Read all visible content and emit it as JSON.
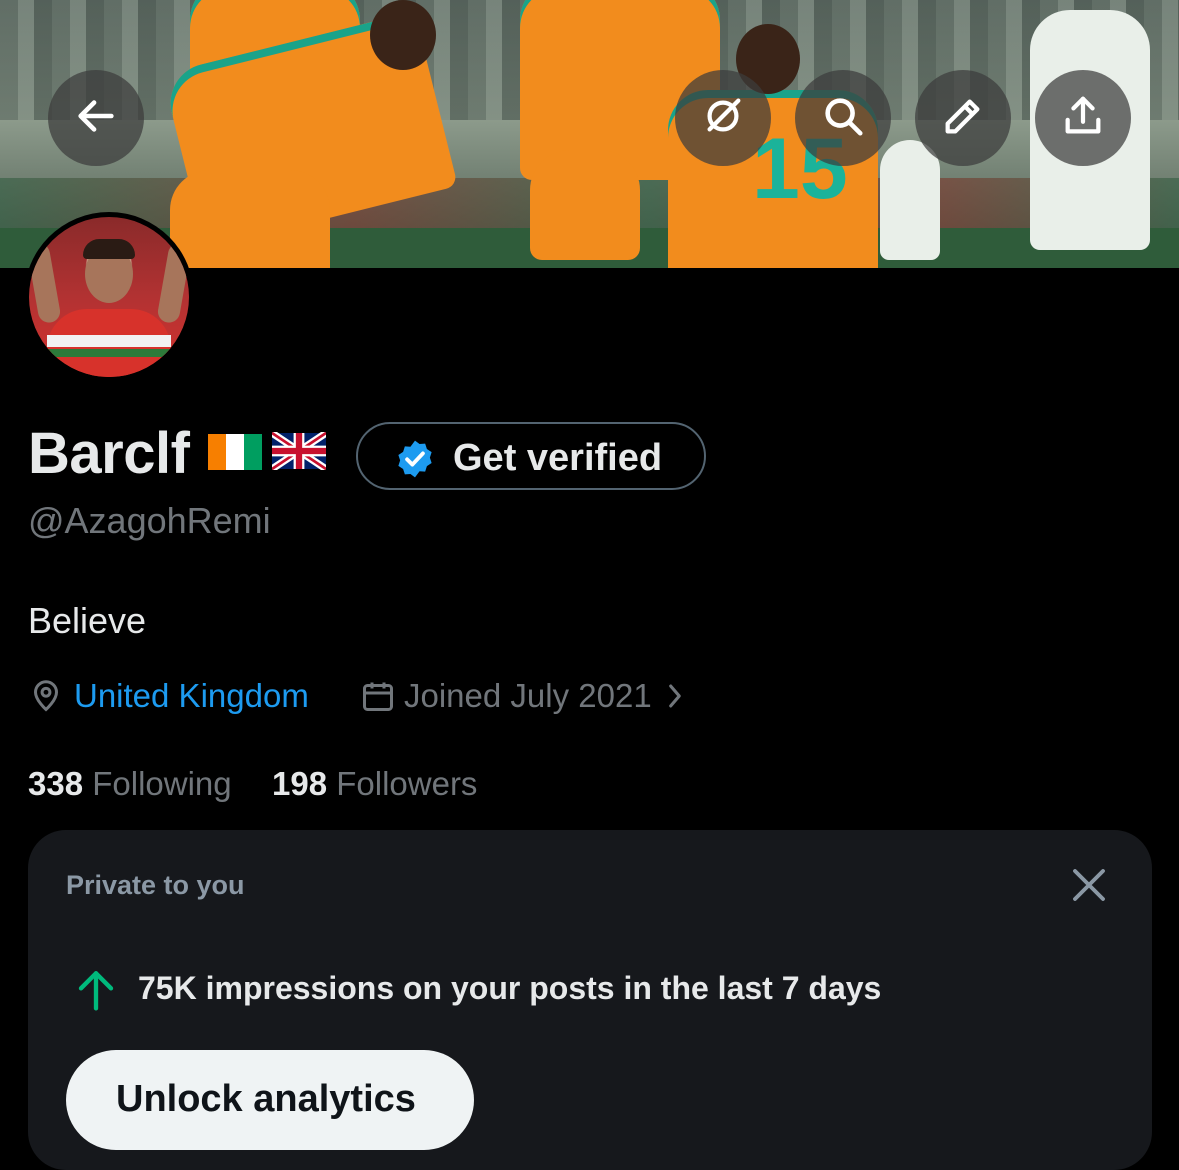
{
  "header": {
    "back_icon": "back-arrow-icon",
    "grok_icon": "grok-icon",
    "search_icon": "search-icon",
    "edit_icon": "pencil-icon",
    "share_icon": "share-icon"
  },
  "profile": {
    "display_name": "Barclf",
    "flags": [
      "Côte d'Ivoire flag",
      "United Kingdom flag"
    ],
    "verify_button_label": "Get verified",
    "handle": "@AzagohRemi",
    "bio": "Believe",
    "location": "United Kingdom",
    "joined": "Joined July 2021",
    "following_count": "338",
    "following_label": "Following",
    "followers_count": "198",
    "followers_label": "Followers"
  },
  "private_card": {
    "title": "Private to you",
    "impressions_text": "75K impressions on your posts in the last 7 days",
    "unlock_button_label": "Unlock analytics"
  },
  "colors": {
    "background": "#000000",
    "accent_link": "#1d9bf0",
    "muted_text": "#71767b",
    "card_bg": "#16181c",
    "up_arrow": "#00ba7c"
  }
}
